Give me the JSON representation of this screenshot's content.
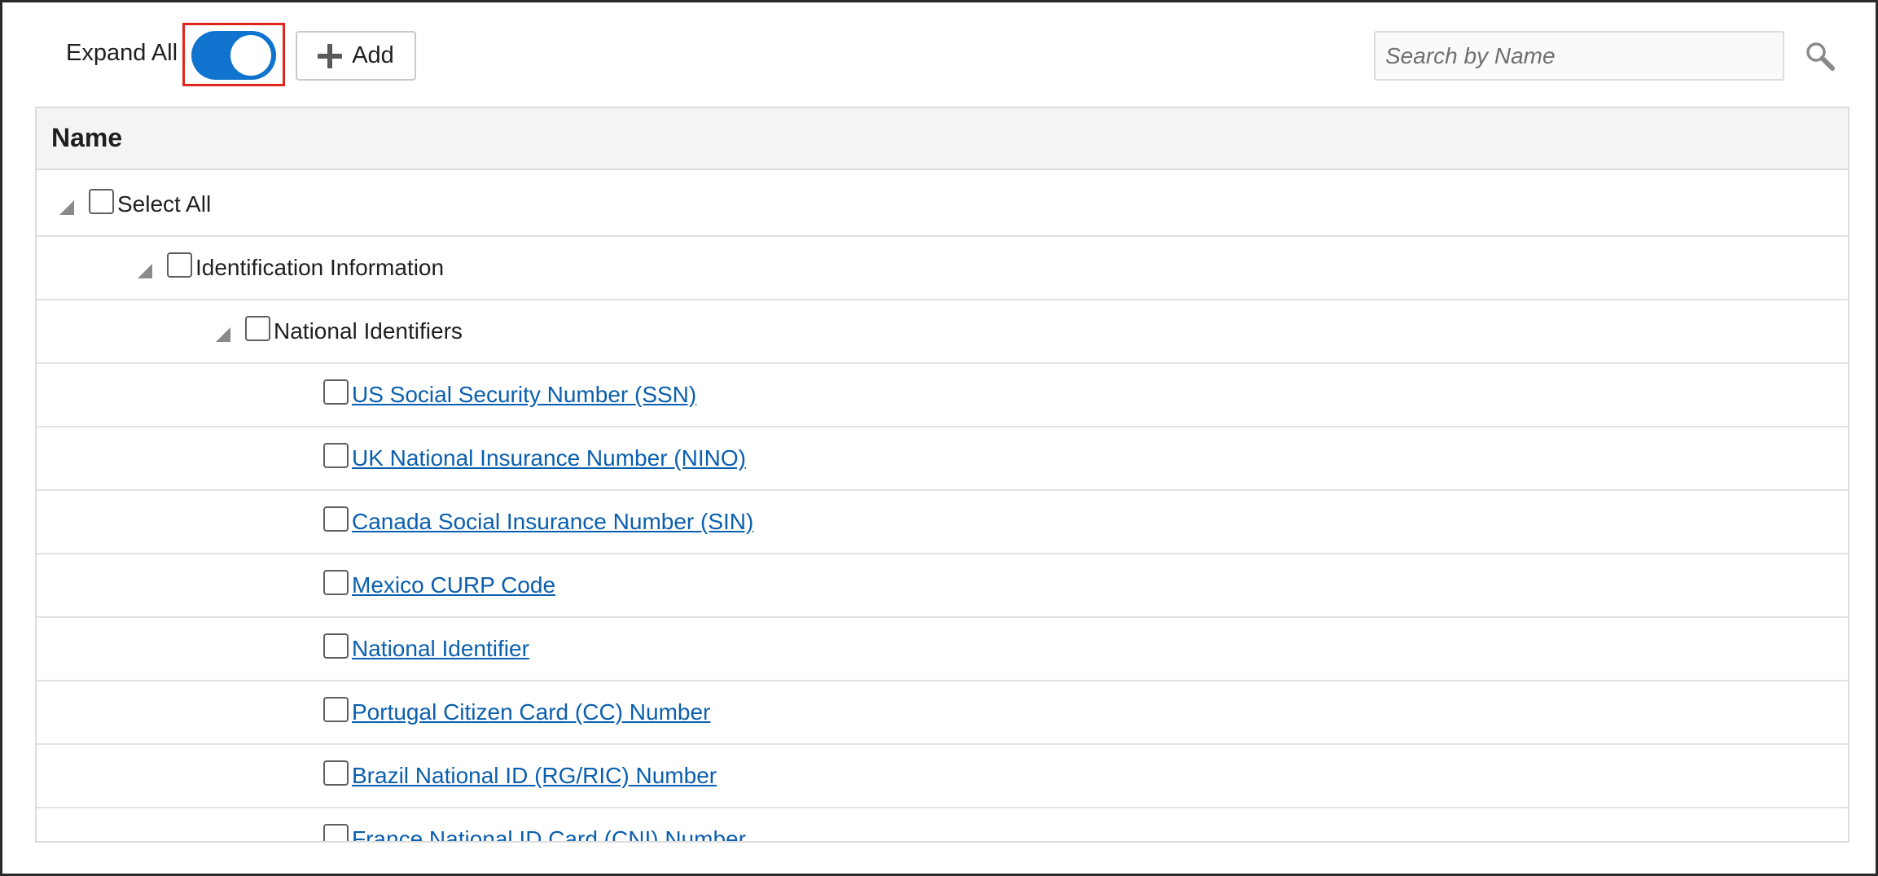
{
  "toolbar": {
    "expand_all_label": "Expand All",
    "expand_all_on": true,
    "add_label": "Add",
    "search_placeholder": "Search by Name"
  },
  "table": {
    "header": "Name",
    "rows": [
      {
        "label": "Select All",
        "level": 0,
        "expandable": true,
        "link": false
      },
      {
        "label": "Identification Information",
        "level": 1,
        "expandable": true,
        "link": false
      },
      {
        "label": "National Identifiers",
        "level": 2,
        "expandable": true,
        "link": false
      },
      {
        "label": "US Social Security Number (SSN)",
        "level": 3,
        "expandable": false,
        "link": true
      },
      {
        "label": "UK National Insurance Number (NINO)",
        "level": 3,
        "expandable": false,
        "link": true
      },
      {
        "label": "Canada Social Insurance Number (SIN)",
        "level": 3,
        "expandable": false,
        "link": true
      },
      {
        "label": "Mexico CURP Code",
        "level": 3,
        "expandable": false,
        "link": true
      },
      {
        "label": "National Identifier",
        "level": 3,
        "expandable": false,
        "link": true
      },
      {
        "label": "Portugal Citizen Card (CC) Number",
        "level": 3,
        "expandable": false,
        "link": true
      },
      {
        "label": "Brazil National ID (RG/RIC) Number",
        "level": 3,
        "expandable": false,
        "link": true
      },
      {
        "label": "France National ID Card (CNI) Number",
        "level": 3,
        "expandable": false,
        "link": true
      }
    ]
  },
  "colors": {
    "toggle_on": "#1074cf",
    "highlight": "#e0261c",
    "link": "#0b5fae"
  }
}
